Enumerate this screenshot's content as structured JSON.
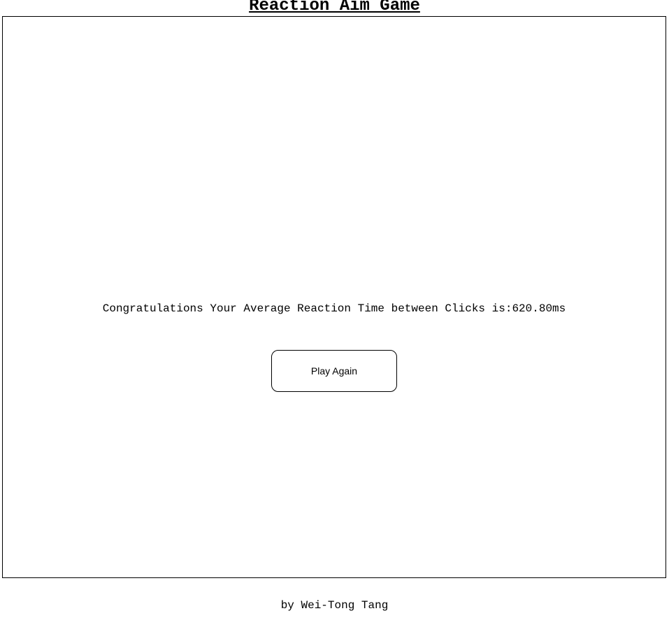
{
  "header": {
    "title": "Reaction Aim Game"
  },
  "game": {
    "result_prefix": "Congratulations Your Average Reaction Time between Clicks is:",
    "average_reaction_time": "620.80ms",
    "play_again_label": "Play Again"
  },
  "footer": {
    "credit": "by Wei-Tong Tang"
  },
  "colors": {
    "background": "#ffffff",
    "border": "#000000",
    "text": "#000000"
  }
}
